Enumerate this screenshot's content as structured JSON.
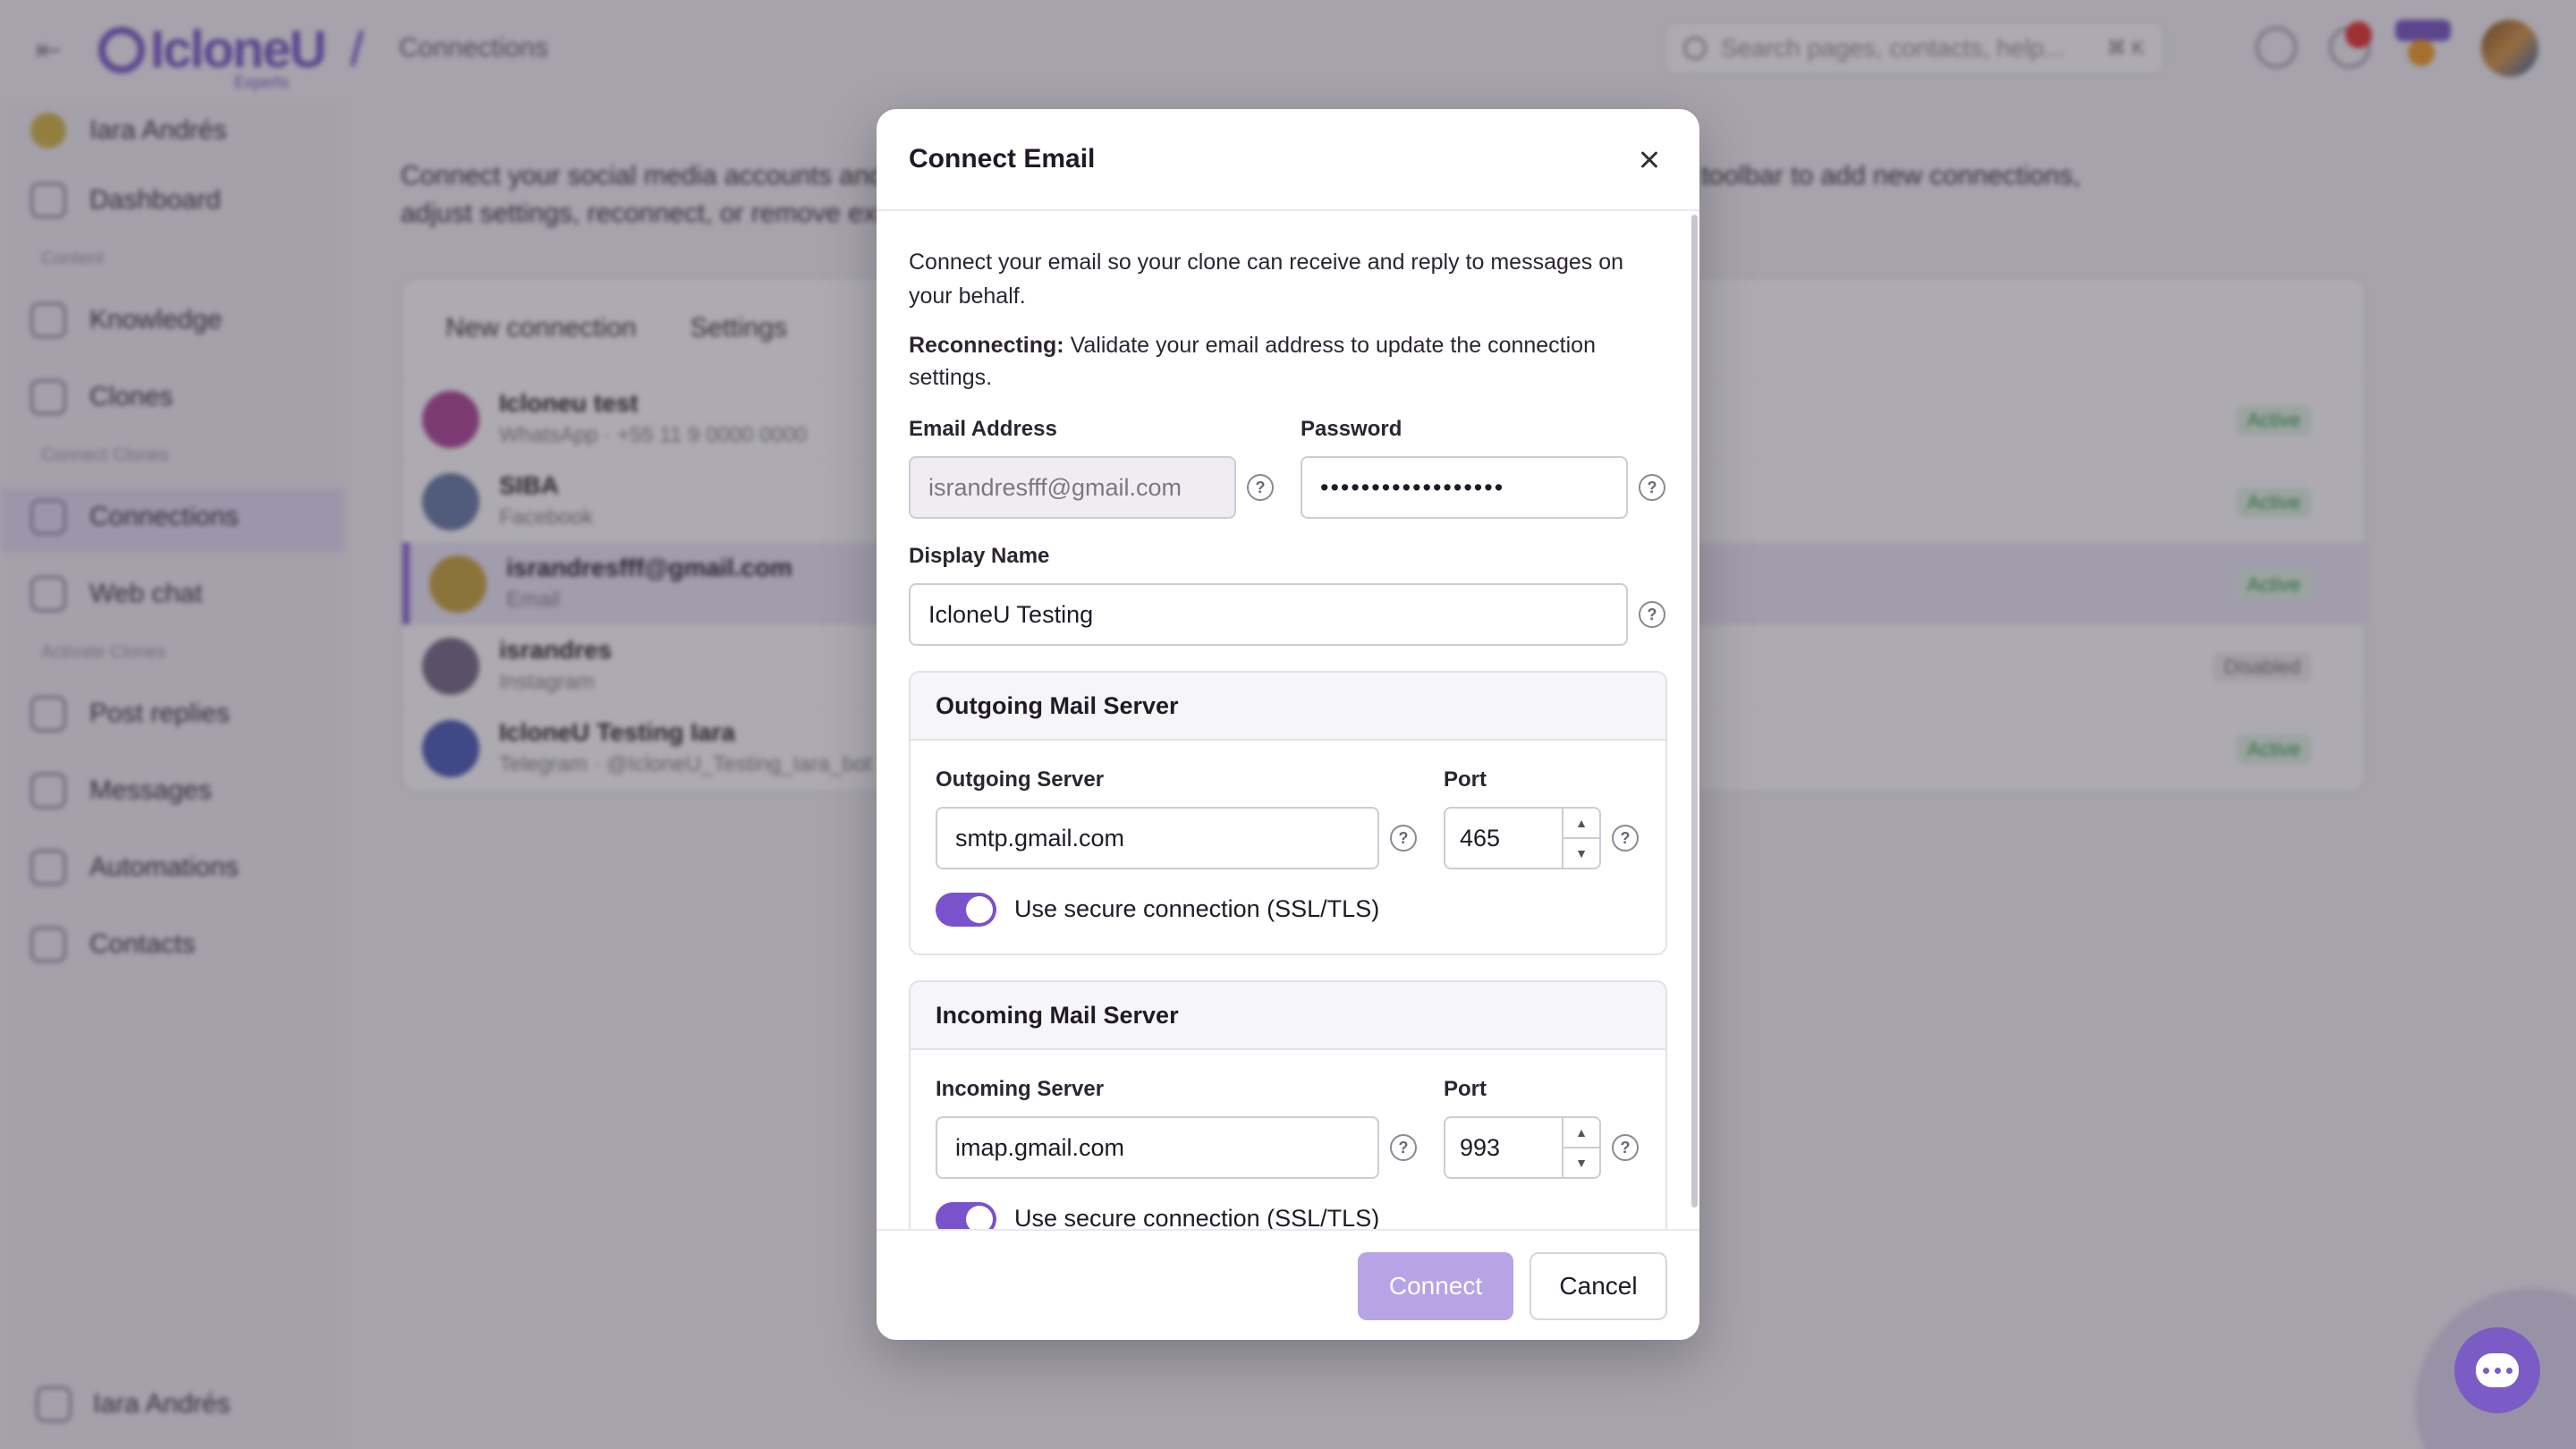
{
  "topbar": {
    "logo_text": "IcloneU",
    "logo_sub": "Experts",
    "breadcrumb": "Connections",
    "search_placeholder": "Search pages, contacts, help...",
    "search_shortcut": "⌘ K"
  },
  "sidebar": {
    "user_name": "Iara Andrés",
    "items": [
      {
        "label": "Dashboard"
      },
      {
        "label": "Knowledge"
      },
      {
        "label": "Clones"
      },
      {
        "label": "Connections"
      },
      {
        "label": "Web chat"
      },
      {
        "label": "Post replies"
      },
      {
        "label": "Messages"
      },
      {
        "label": "Automations"
      },
      {
        "label": "Contacts"
      }
    ],
    "sections": [
      "Content",
      "Connect Clones",
      "Activate Clones"
    ],
    "footer_user": "Iara Andrés"
  },
  "main": {
    "description": "Connect your social media accounts and messaging apps so your clone can respond on your behalf. Use the toolbar to add new connections, adjust settings, reconnect, or remove existing ones.",
    "toolbar": {
      "new_connection": "New connection",
      "settings": "Settings"
    },
    "connections": [
      {
        "name": "Icloneu test",
        "sub": "WhatsApp · +55 11 9 0000 0000",
        "status": "Active",
        "color": "#b04a9c"
      },
      {
        "name": "SIBA",
        "sub": "Facebook",
        "status": "Active",
        "color": "#6b7fa8"
      },
      {
        "name": "israndresfff@gmail.com",
        "sub": "Email",
        "status": "Active",
        "color": "#c8a640"
      },
      {
        "name": "israndres",
        "sub": "Instagram",
        "status": "Disabled",
        "color": "#7a6f8a"
      },
      {
        "name": "IcloneU Testing Iara",
        "sub": "Telegram · @IcloneU_Testing_Iara_bot",
        "status": "Active",
        "color": "#4f5fb8"
      }
    ]
  },
  "modal": {
    "title": "Connect Email",
    "intro": "Connect your email so your clone can receive and reply to messages on your behalf.",
    "reconnect_bold": "Reconnecting:",
    "reconnect_text": "Validate your email address to update the connection settings.",
    "email_label": "Email Address",
    "email_value": "israndresfff@gmail.com",
    "password_label": "Password",
    "password_value": "••••••••••••••••••",
    "display_name_label": "Display Name",
    "display_name_value": "IcloneU Testing",
    "outgoing": {
      "title": "Outgoing Mail Server",
      "server_label": "Outgoing Server",
      "server_value": "smtp.gmail.com",
      "port_label": "Port",
      "port_value": "465",
      "secure_label": "Use secure connection (SSL/TLS)",
      "secure_on": true
    },
    "incoming": {
      "title": "Incoming Mail Server",
      "server_label": "Incoming Server",
      "server_value": "imap.gmail.com",
      "port_label": "Port",
      "port_value": "993",
      "secure_label": "Use secure connection (SSL/TLS)",
      "secure_on": true
    },
    "help_glyph": "?",
    "connect_label": "Connect",
    "cancel_label": "Cancel"
  },
  "colors": {
    "accent": "#7a52cc",
    "connect_disabled": "#b7a3e6",
    "status_active": "#2e9c49"
  }
}
